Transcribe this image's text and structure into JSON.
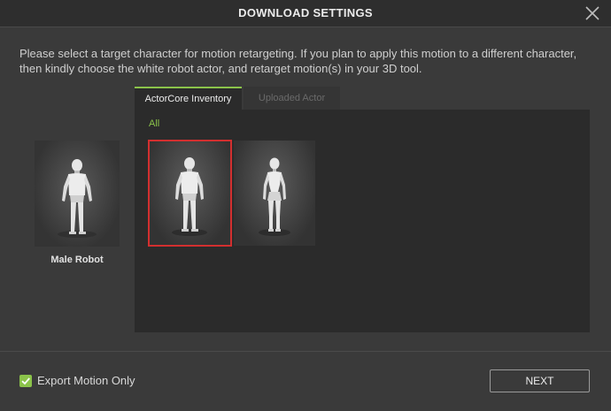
{
  "dialog": {
    "title": "DOWNLOAD SETTINGS",
    "description": "Please select a target character for motion retargeting. If you plan to apply this motion to a different character, then kindly choose the white robot actor, and retarget motion(s) in your 3D tool."
  },
  "preview": {
    "name": "Male Robot"
  },
  "tabs": [
    {
      "label": "ActorCore Inventory",
      "active": true
    },
    {
      "label": "Uploaded Actor",
      "active": false
    }
  ],
  "filter": {
    "label": "All"
  },
  "characters": [
    {
      "icon": "male-robot-figure",
      "selected": true
    },
    {
      "icon": "female-robot-figure",
      "selected": false
    }
  ],
  "footer": {
    "export_checkbox_label": "Export Motion Only",
    "export_checked": true,
    "next_label": "NEXT"
  },
  "colors": {
    "accent": "#8bc34a",
    "selection": "#d32f2f",
    "background": "#3a3a3a",
    "panel": "#2b2b2b"
  }
}
